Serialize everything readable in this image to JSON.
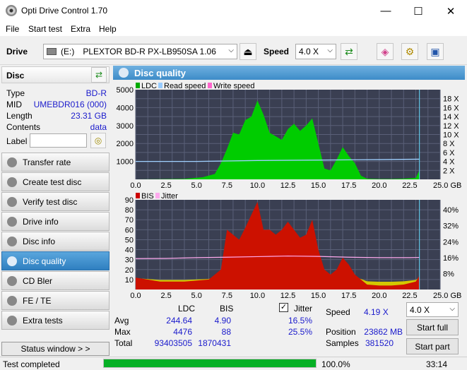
{
  "window": {
    "title": "Opti Drive Control 1.70",
    "minimize": "—",
    "maximize": "☐",
    "close": "✕"
  },
  "menu": [
    "File",
    "Start test",
    "Extra",
    "Help"
  ],
  "toolbar": {
    "drive_label": "Drive",
    "drive_letter": "(E:)",
    "drive_name": "PLEXTOR BD-R  PX-LB950SA 1.06",
    "speed_label": "Speed",
    "speed_value": "4.0 X"
  },
  "disc": {
    "header": "Disc",
    "rows": [
      {
        "key": "Type",
        "value": "BD-R"
      },
      {
        "key": "MID",
        "value": "UMEBDR016 (000)"
      },
      {
        "key": "Length",
        "value": "23.31 GB"
      },
      {
        "key": "Contents",
        "value": "data"
      }
    ],
    "label_key": "Label",
    "label_value": ""
  },
  "nav": [
    {
      "label": "Transfer rate",
      "active": false
    },
    {
      "label": "Create test disc",
      "active": false
    },
    {
      "label": "Verify test disc",
      "active": false
    },
    {
      "label": "Drive info",
      "active": false
    },
    {
      "label": "Disc info",
      "active": false
    },
    {
      "label": "Disc quality",
      "active": true
    },
    {
      "label": "CD Bler",
      "active": false
    },
    {
      "label": "FE / TE",
      "active": false
    },
    {
      "label": "Extra tests",
      "active": false
    }
  ],
  "status_window_btn": "Status window > >",
  "panel_title": "Disc quality",
  "chart_data": [
    {
      "type": "area",
      "legend": [
        "LDC",
        "Read speed",
        "Write speed"
      ],
      "colors": {
        "LDC": "#00cc00",
        "Read speed": "#99ccff",
        "Write speed": "#ff66cc"
      },
      "x_ticks": [
        "0.0",
        "2.5",
        "5.0",
        "7.5",
        "10.0",
        "12.5",
        "15.0",
        "17.5",
        "20.0",
        "22.5",
        "25.0 GB"
      ],
      "y_left_ticks": [
        "5000",
        "4000",
        "3000",
        "2000",
        "1000"
      ],
      "y_right_ticks": [
        "18 X",
        "16 X",
        "14 X",
        "12 X",
        "10 X",
        "8 X",
        "6 X",
        "4 X",
        "2 X"
      ],
      "xlim": [
        0,
        25
      ],
      "ylim": [
        0,
        5000
      ],
      "series": [
        {
          "name": "LDC",
          "x": [
            0,
            2,
            4,
            5.5,
            6.5,
            7,
            7.5,
            8,
            8.5,
            9,
            9.5,
            10,
            10.5,
            11,
            11.5,
            12,
            12.5,
            13,
            13.5,
            14,
            14.5,
            15,
            15.5,
            16,
            16.5,
            17,
            17.5,
            18,
            18.5,
            19,
            20,
            21,
            22,
            23,
            23.3
          ],
          "y": [
            0,
            10,
            30,
            120,
            300,
            900,
            1700,
            2600,
            2500,
            3300,
            3500,
            4400,
            3600,
            2600,
            2400,
            2200,
            2800,
            3100,
            2700,
            3000,
            3400,
            2000,
            600,
            500,
            1100,
            1800,
            1300,
            900,
            200,
            40,
            20,
            20,
            40,
            80,
            500
          ]
        },
        {
          "name": "Read speed",
          "x": [
            0,
            5,
            10,
            15,
            20,
            23.3
          ],
          "y": [
            4.0,
            4.0,
            4.2,
            4.3,
            4.4,
            4.5
          ]
        }
      ]
    },
    {
      "type": "area",
      "legend": [
        "BIS",
        "Jitter"
      ],
      "colors": {
        "BIS": "#cc0000",
        "Jitter": "#ffaaee"
      },
      "x_ticks": [
        "0.0",
        "2.5",
        "5.0",
        "7.5",
        "10.0",
        "12.5",
        "15.0",
        "17.5",
        "20.0",
        "22.5",
        "25.0 GB"
      ],
      "y_left_ticks": [
        "90",
        "80",
        "70",
        "60",
        "50",
        "40",
        "30",
        "20",
        "10"
      ],
      "y_right_ticks": [
        "40%",
        "32%",
        "24%",
        "16%",
        "8%"
      ],
      "xlim": [
        0,
        25
      ],
      "ylim": [
        0,
        90
      ],
      "series": [
        {
          "name": "BIS",
          "x": [
            0,
            2,
            4,
            6,
            7,
            7.5,
            8,
            8.5,
            9,
            9.5,
            10,
            10.5,
            11,
            11.5,
            12,
            12.5,
            13,
            13.5,
            14,
            14.5,
            15,
            15.5,
            16,
            16.5,
            17,
            17.5,
            18,
            18.5,
            19,
            20,
            21,
            22,
            23,
            23.3
          ],
          "y": [
            12,
            8,
            8,
            10,
            20,
            60,
            55,
            50,
            62,
            75,
            88,
            60,
            60,
            55,
            60,
            68,
            60,
            52,
            55,
            70,
            40,
            20,
            15,
            20,
            32,
            25,
            15,
            10,
            5,
            4,
            4,
            5,
            8,
            14
          ]
        },
        {
          "name": "Jitter",
          "x": [
            0,
            2.5,
            5,
            7.5,
            10,
            12.5,
            15,
            17.5,
            20,
            22.5,
            23.3
          ],
          "y": [
            15.5,
            15.6,
            16.0,
            16.2,
            16.5,
            16.8,
            16.6,
            16.2,
            16.0,
            16.0,
            16.1
          ]
        }
      ]
    }
  ],
  "stats": {
    "col_ldc": "LDC",
    "col_bis": "BIS",
    "jitter_label": "Jitter",
    "rows": [
      {
        "label": "Avg",
        "ldc": "244.64",
        "bis": "4.90",
        "jitter": "16.5%"
      },
      {
        "label": "Max",
        "ldc": "4476",
        "bis": "88",
        "jitter": "25.5%"
      },
      {
        "label": "Total",
        "ldc": "93403505",
        "bis": "1870431",
        "jitter": ""
      }
    ],
    "speed_label": "Speed",
    "speed_value": "4.19 X",
    "speed_select": "4.0 X",
    "position_label": "Position",
    "position_value": "23862 MB",
    "samples_label": "Samples",
    "samples_value": "381520",
    "start_full": "Start full",
    "start_part": "Start part"
  },
  "statusbar": {
    "text": "Test completed",
    "progress": 1.0,
    "progress_text": "100.0%",
    "time": "33:14"
  }
}
